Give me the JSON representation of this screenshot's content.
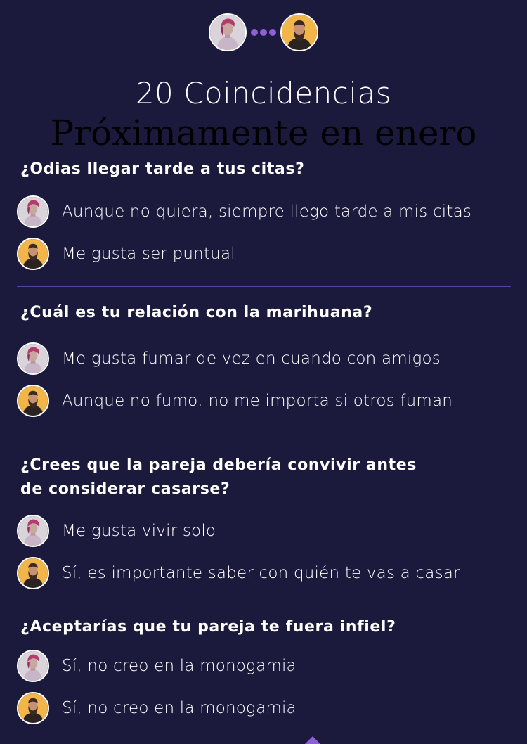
{
  "header": {
    "title": "20 Coincidencias",
    "subtitle": "Próximamente en enero"
  },
  "icons": {
    "user_a": "woman-avatar-icon",
    "user_b": "bearded-man-avatar-icon",
    "separator": "dots-separator-icon"
  },
  "colors": {
    "background": "#1b1a3d",
    "accent": "#8e5fd6",
    "divider": "#5d3f9c"
  },
  "sections": [
    {
      "question": "¿Odias llegar tarde a tus citas?",
      "answers": [
        {
          "user": "woman",
          "text": "Aunque no quiera, siempre llego tarde a mis citas"
        },
        {
          "user": "man",
          "text": "Me gusta ser puntual"
        }
      ]
    },
    {
      "question": "¿Cuál es tu relación con la marihuana?",
      "answers": [
        {
          "user": "woman",
          "text": "Me gusta fumar de vez en cuando con amigos"
        },
        {
          "user": "man",
          "text": "Aunque no fumo, no me importa si otros fuman"
        }
      ]
    },
    {
      "question": "¿Crees que la pareja debería convivir antes\nde considerar casarse?",
      "answers": [
        {
          "user": "woman",
          "text": "Me gusta vivir solo"
        },
        {
          "user": "man",
          "text": "Sí, es importante saber con quién te vas a casar"
        }
      ]
    },
    {
      "question": "¿Aceptarías que tu pareja te fuera infiel?",
      "answers": [
        {
          "user": "woman",
          "text": "Sí, no creo en la monogamia"
        },
        {
          "user": "man",
          "text": "Sí, no creo en la monogamia"
        }
      ]
    }
  ]
}
